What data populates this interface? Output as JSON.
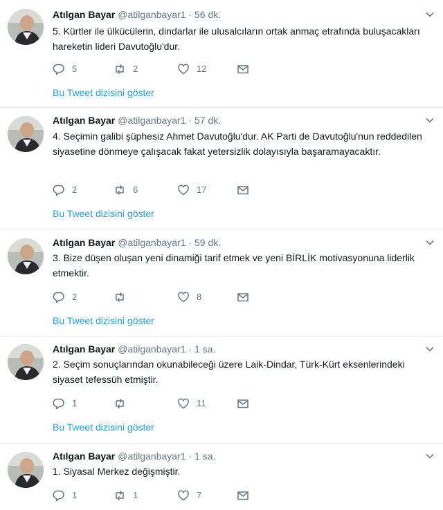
{
  "tweets": [
    {
      "name": "Atılgan Bayar",
      "handle": "@atilganbayar1",
      "separator": "·",
      "time": "56 dk.",
      "text": "5. Kürtler ile ülkücülerin, dindarlar ile ulusalcıların ortak anmaç etrafında buluşacakları hareketin lideri Davutoğlu'dur.",
      "replies": "5",
      "retweets": "2",
      "likes": "12",
      "thread_link": "Bu Tweet dizisini göster"
    },
    {
      "name": "Atılgan Bayar",
      "handle": "@atilganbayar1",
      "separator": "·",
      "time": "57 dk.",
      "text": "4. Seçimin galibi şüphesiz Ahmet Davutoğlu'dur. AK Parti de Davutoğlu'nun reddedilen siyasetine dönmeye çalışacak fakat yetersizlik dolayısıyla başaramayacaktır.",
      "replies": "2",
      "retweets": "6",
      "likes": "17",
      "thread_link": "Bu Tweet dizisini göster"
    },
    {
      "name": "Atılgan Bayar",
      "handle": "@atilganbayar1",
      "separator": "·",
      "time": "59 dk.",
      "text": "3. Bize düşen oluşan yeni dinamiği tarif etmek ve yeni BİRLİK motivasyonuna liderlik etmektir.",
      "replies": "2",
      "retweets": "",
      "likes": "8",
      "thread_link": "Bu Tweet dizisini göster"
    },
    {
      "name": "Atılgan Bayar",
      "handle": "@atilganbayar1",
      "separator": "·",
      "time": "1 sa.",
      "text": "2. Seçim sonuçlarından okunabileceği üzere Laik-Dindar, Türk-Kürt eksenlerindeki siyaset tefessüh etmiştir.",
      "replies": "1",
      "retweets": "",
      "likes": "11",
      "thread_link": "Bu Tweet dizisini göster"
    },
    {
      "name": "Atılgan Bayar",
      "handle": "@atilganbayar1",
      "separator": "·",
      "time": "1 sa.",
      "text": "1. Siyasal Merkez değişmiştir.",
      "replies": "1",
      "retweets": "1",
      "likes": "7",
      "thread_link": ""
    }
  ],
  "colors": {
    "text": "#14171a",
    "muted": "#657786",
    "link": "#1da1f2",
    "divider": "#e6ecf0"
  },
  "icons": {
    "reply": "speech-bubble",
    "retweet": "retweet-arrows",
    "like": "heart-outline",
    "message": "envelope",
    "menu": "chevron-down"
  }
}
